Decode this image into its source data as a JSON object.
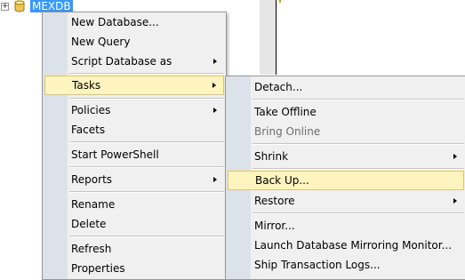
{
  "tree": {
    "expander": "+",
    "database_name": "MEXDB"
  },
  "context_menu": {
    "items": [
      {
        "label": "New Database..."
      },
      {
        "label": "New Query"
      },
      {
        "label": "Script Database as"
      },
      {
        "label": "Tasks"
      },
      {
        "label": "Policies"
      },
      {
        "label": "Facets"
      },
      {
        "label": "Start PowerShell"
      },
      {
        "label": "Reports"
      },
      {
        "label": "Rename"
      },
      {
        "label": "Delete"
      },
      {
        "label": "Refresh"
      },
      {
        "label": "Properties"
      }
    ]
  },
  "tasks_submenu": {
    "items": [
      {
        "label": "Detach..."
      },
      {
        "label": "Take Offline"
      },
      {
        "label": "Bring Online"
      },
      {
        "label": "Shrink"
      },
      {
        "label": "Back Up..."
      },
      {
        "label": "Restore"
      },
      {
        "label": "Mirror..."
      },
      {
        "label": "Launch Database Mirroring Monitor..."
      },
      {
        "label": "Ship Transaction Logs..."
      }
    ]
  },
  "colors": {
    "selection": "#3399ff",
    "highlight_fill": "#fdf4bf",
    "highlight_border": "#e5c365",
    "menu_bg": "#f0f0f0",
    "icon_strip": "#dce2ea"
  }
}
